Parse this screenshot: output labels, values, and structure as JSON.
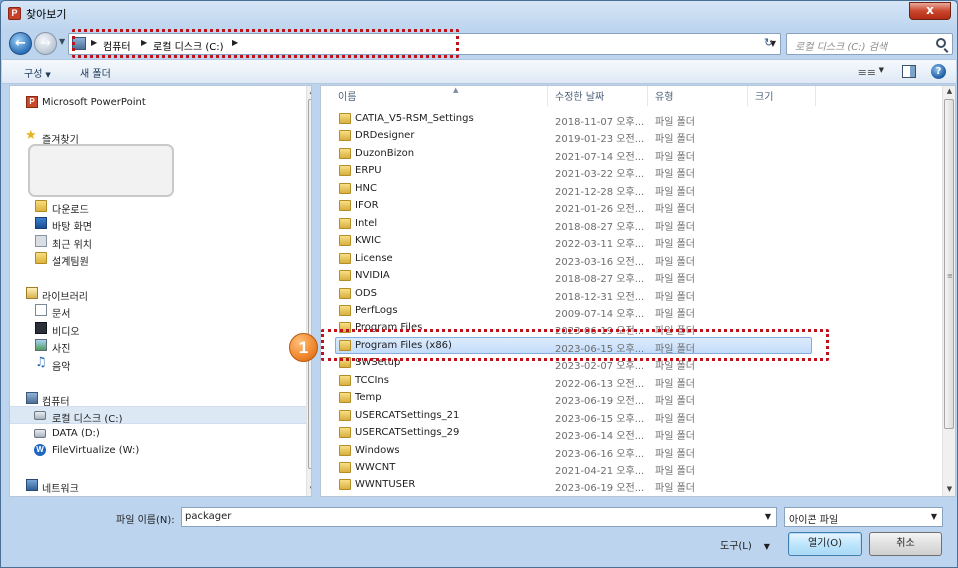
{
  "window": {
    "title": "찾아보기",
    "close_label": "x"
  },
  "address": {
    "crumbs": [
      "컴퓨터",
      "로컬 디스크 (C:)"
    ],
    "search_placeholder": "로컬 디스크 (C:) 검색"
  },
  "toolbar": {
    "organize": "구성",
    "new_folder": "새 폴더"
  },
  "nav": {
    "powerpoint": "Microsoft PowerPoint",
    "favorites": "즐겨찾기",
    "downloads": "다운로드",
    "desktop": "바탕 화면",
    "recent": "최근 위치",
    "team": "설계팀원",
    "libraries": "라이브러리",
    "documents": "문서",
    "videos": "비디오",
    "pictures": "사진",
    "music": "음악",
    "computer": "컴퓨터",
    "local_disk": "로컬 디스크 (C:)",
    "data_drive": "DATA (D:)",
    "filevirtualize": "FileVirtualize (W:)",
    "network": "네트워크"
  },
  "columns": {
    "name": "이름",
    "modified": "수정한 날짜",
    "type": "유형",
    "size": "크기"
  },
  "files": [
    {
      "name": "CATIA_V5-RSM_Settings",
      "date": "2018-11-07 오후...",
      "type": "파일 폴더"
    },
    {
      "name": "DRDesigner",
      "date": "2019-01-23 오전...",
      "type": "파일 폴더"
    },
    {
      "name": "DuzonBizon",
      "date": "2021-07-14 오전...",
      "type": "파일 폴더"
    },
    {
      "name": "ERPU",
      "date": "2021-03-22 오후...",
      "type": "파일 폴더"
    },
    {
      "name": "HNC",
      "date": "2021-12-28 오후...",
      "type": "파일 폴더"
    },
    {
      "name": "IFOR",
      "date": "2021-01-26 오전...",
      "type": "파일 폴더"
    },
    {
      "name": "Intel",
      "date": "2018-08-27 오후...",
      "type": "파일 폴더"
    },
    {
      "name": "KWIC",
      "date": "2022-03-11 오후...",
      "type": "파일 폴더"
    },
    {
      "name": "License",
      "date": "2023-03-16 오전...",
      "type": "파일 폴더"
    },
    {
      "name": "NVIDIA",
      "date": "2018-08-27 오후...",
      "type": "파일 폴더"
    },
    {
      "name": "ODS",
      "date": "2018-12-31 오전...",
      "type": "파일 폴더"
    },
    {
      "name": "PerfLogs",
      "date": "2009-07-14 오후...",
      "type": "파일 폴더"
    },
    {
      "name": "Program Files",
      "date": "2023-06-19 오전...",
      "type": "파일 폴더"
    },
    {
      "name": "Program Files (x86)",
      "date": "2023-06-15 오후...",
      "type": "파일 폴더",
      "selected": true
    },
    {
      "name": "SWSetup",
      "date": "2023-02-07 오후...",
      "type": "파일 폴더"
    },
    {
      "name": "TCCIns",
      "date": "2022-06-13 오전...",
      "type": "파일 폴더"
    },
    {
      "name": "Temp",
      "date": "2023-06-19 오전...",
      "type": "파일 폴더"
    },
    {
      "name": "USERCATSettings_21",
      "date": "2023-06-15 오후...",
      "type": "파일 폴더"
    },
    {
      "name": "USERCATSettings_29",
      "date": "2023-06-14 오전...",
      "type": "파일 폴더"
    },
    {
      "name": "Windows",
      "date": "2023-06-16 오후...",
      "type": "파일 폴더"
    },
    {
      "name": "WWCNT",
      "date": "2021-04-21 오후...",
      "type": "파일 폴더"
    },
    {
      "name": "WWNTUSER",
      "date": "2023-06-19 오전...",
      "type": "파일 폴더"
    }
  ],
  "annotation": {
    "step": "1"
  },
  "footer": {
    "filename_label": "파일 이름(N):",
    "filename_value": "packager",
    "filetype_value": "아이콘 파일",
    "tools_label": "도구(L)",
    "open_label": "열기(O)",
    "cancel_label": "취소"
  },
  "colors": {
    "highlight": "#c1121c",
    "badge": "#f0862c",
    "selection": "#c4ddfa"
  }
}
